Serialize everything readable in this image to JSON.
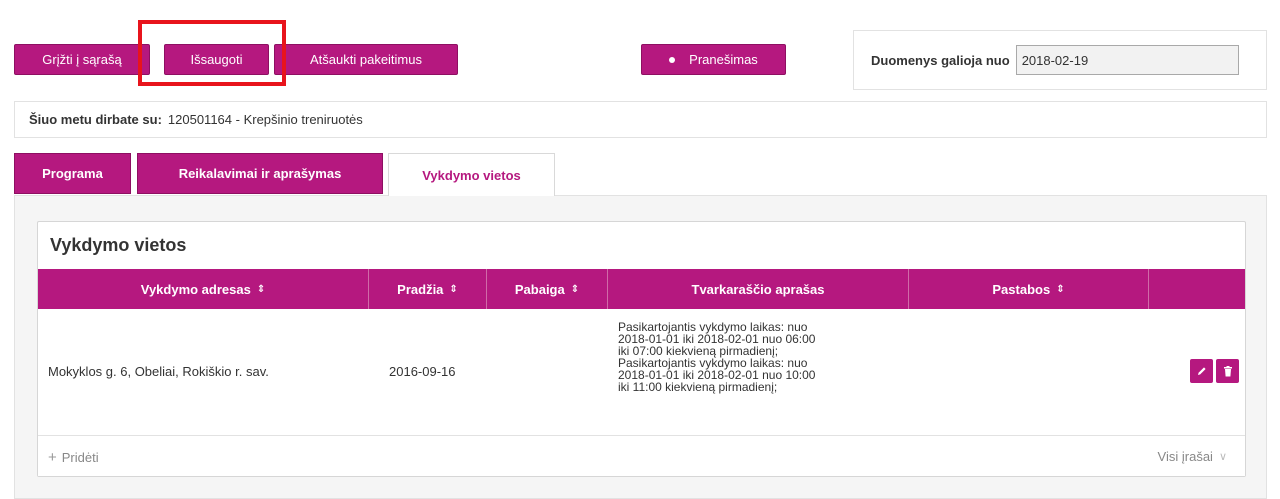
{
  "toolbar": {
    "back_label": "Grįžti į sąrašą",
    "save_label": "Išsaugoti",
    "cancel_label": "Atšaukti pakeitimus",
    "notify_label": "Pranešimas"
  },
  "validity": {
    "label": "Duomenys galioja nuo",
    "value": "2018-02-19"
  },
  "current": {
    "label": "Šiuo metu dirbate su:",
    "value": "120501164 - Krepšinio treniruotės"
  },
  "tabs": [
    {
      "label": "Programa",
      "active": false
    },
    {
      "label": "Reikalavimai ir aprašymas",
      "active": false
    },
    {
      "label": "Vykdymo vietos",
      "active": true
    }
  ],
  "panel": {
    "title": "Vykdymo vietos",
    "columns": [
      {
        "label": "Vykdymo adresas",
        "sortable": true
      },
      {
        "label": "Pradžia",
        "sortable": true
      },
      {
        "label": "Pabaiga",
        "sortable": true
      },
      {
        "label": "Tvarkaraščio aprašas",
        "sortable": false
      },
      {
        "label": "Pastabos",
        "sortable": true
      },
      {
        "label": "",
        "sortable": false
      }
    ],
    "rows": [
      {
        "address": "Mokyklos g. 6, Obeliai, Rokiškio r. sav.",
        "start": "2016-09-16",
        "end": "",
        "schedule_lines": [
          "Pasikartojantis vykdymo laikas: nuo",
          "2018-01-01 iki 2018-02-01 nuo 06:00",
          "iki 07:00 kiekvieną pirmadienį;",
          "Pasikartojantis vykdymo laikas: nuo",
          "2018-01-01 iki 2018-02-01 nuo 10:00",
          "iki 11:00 kiekvieną pirmadienį;"
        ],
        "notes": ""
      }
    ],
    "add_label": "Pridėti",
    "all_records_label": "Visi įrašai"
  },
  "colors": {
    "brand": "#b5187f",
    "highlight": "#e8141c"
  },
  "icons": {
    "sort": "sort-icon",
    "edit": "pencil-icon",
    "delete": "trash-icon",
    "add": "plus-icon",
    "expand": "chevron-down-icon",
    "notify": "dot-icon"
  }
}
